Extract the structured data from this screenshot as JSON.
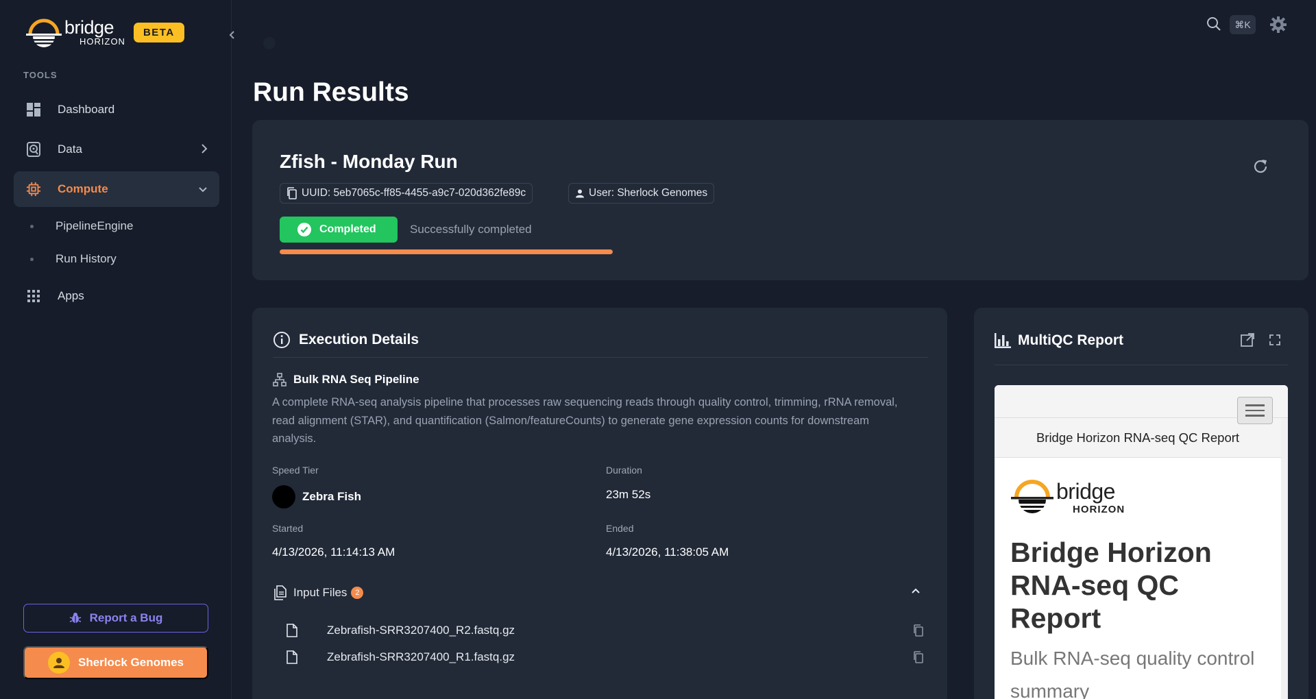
{
  "brand": {
    "name": "bridge",
    "subname": "HORIZON",
    "badge": "BETA"
  },
  "sidebar": {
    "section_label": "TOOLS",
    "items": [
      {
        "label": "Dashboard",
        "icon": "dashboard-icon"
      },
      {
        "label": "Data",
        "icon": "database-icon"
      },
      {
        "label": "Compute",
        "icon": "cpu-icon",
        "active": true
      },
      {
        "label": "Apps",
        "icon": "apps-grid-icon"
      }
    ],
    "sub_items": [
      {
        "label": "PipelineEngine"
      },
      {
        "label": "Run History"
      }
    ],
    "report_bug": "Report a Bug",
    "user": "Sherlock Genomes"
  },
  "topbar": {
    "shortcut": "⌘K"
  },
  "page": {
    "title": "Run Results"
  },
  "run": {
    "title": "Zfish - Monday Run",
    "uuid": "UUID: 5eb7065c-ff85-4455-a9c7-020d362fe89c",
    "user": "User: Sherlock Genomes",
    "status": "Completed",
    "status_text": "Successfully completed",
    "progress": 1.0
  },
  "execution": {
    "heading": "Execution Details",
    "pipeline_name": "Bulk RNA Seq Pipeline",
    "pipeline_desc": "A complete RNA-seq analysis pipeline that processes raw sequencing reads through quality control, trimming, rRNA removal, read alignment (STAR), and quantification (Salmon/featureCounts) to generate gene expression counts for downstream analysis.",
    "speed_tier_label": "Speed Tier",
    "speed_tier_value": "Zebra Fish",
    "duration_label": "Duration",
    "duration_value": "23m 52s",
    "started_label": "Started",
    "started_value": "4/13/2026, 11:14:13 AM",
    "ended_label": "Ended",
    "ended_value": "4/13/2026, 11:38:05 AM",
    "input_files_label": "Input Files",
    "input_files_count": "2",
    "files": [
      "Zebrafish-SRR3207400_R2.fastq.gz",
      "Zebrafish-SRR3207400_R1.fastq.gz"
    ]
  },
  "multiqc": {
    "heading": "MultiQC Report",
    "frame_header": "Bridge Horizon RNA-seq QC Report",
    "logo_name": "bridge",
    "logo_subname": "HORIZON",
    "report_title": "Bridge Horizon RNA-seq QC Report",
    "report_subtitle": "Bulk RNA-seq quality control summary"
  },
  "colors": {
    "accent": "#f58b4c",
    "success": "#22c55e",
    "beta": "#fbbf24",
    "bug": "#6d63e6",
    "background": "#171d2a",
    "card": "#222a38"
  }
}
